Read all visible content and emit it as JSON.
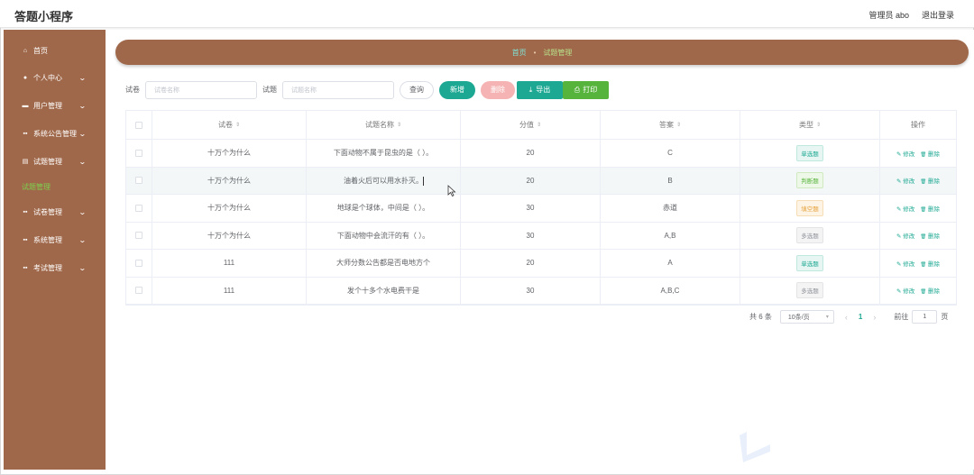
{
  "app": {
    "title": "答题小程序"
  },
  "topbar": {
    "user_label": "管理员 abo",
    "logout_label": "退出登录"
  },
  "sidebar": {
    "items": [
      {
        "label": "首页",
        "icon": "home-icon",
        "glyph": "⌂",
        "has_children": false
      },
      {
        "label": "个人中心",
        "icon": "user-icon",
        "glyph": "●",
        "has_children": true
      },
      {
        "label": "用户管理",
        "icon": "menu-icon",
        "glyph": "▬",
        "has_children": true
      },
      {
        "label": "系统公告管理",
        "icon": "grid-icon",
        "glyph": "▪▪",
        "has_children": true
      },
      {
        "label": "试题管理",
        "icon": "document-icon",
        "glyph": "▤",
        "has_children": true
      },
      {
        "label": "试卷管理",
        "icon": "grid-icon",
        "glyph": "▪▪",
        "has_children": true
      },
      {
        "label": "系统管理",
        "icon": "grid-icon",
        "glyph": "▪▪",
        "has_children": true
      },
      {
        "label": "考试管理",
        "icon": "grid-icon",
        "glyph": "▪▪",
        "has_children": true
      }
    ],
    "active_sub": "试题管理",
    "chevron": "⌄"
  },
  "breadcrumb": {
    "home": "首页",
    "separator": "•",
    "current": "试题管理"
  },
  "search": {
    "paper_label": "试卷",
    "paper_placeholder": "试卷名称",
    "question_label": "试题",
    "question_placeholder": "试题名称",
    "query_button": "查询"
  },
  "toolbar": {
    "add_label": "新增",
    "delete_label": "删除",
    "export_label": "导出",
    "export_icon": "⤓",
    "print_label": "打印",
    "print_icon": "⎙"
  },
  "table": {
    "sort_glyph": "⇕",
    "headers": {
      "paper": "试卷",
      "name": "试题名称",
      "score": "分值",
      "answer": "答案",
      "type": "类型",
      "action": "操作"
    },
    "rows": [
      {
        "paper": "十万个为什么",
        "name": "下面动物不属于昆虫的是（ ）。",
        "score": "20",
        "answer": "C",
        "type": "单选题",
        "type_kind": "single"
      },
      {
        "paper": "十万个为什么",
        "name": "油着火后可以用水扑灭。",
        "score": "20",
        "answer": "B",
        "type": "判断题",
        "type_kind": "judge"
      },
      {
        "paper": "十万个为什么",
        "name": "地球是个球体，中间是（ ）。",
        "score": "30",
        "answer": "赤道",
        "type": "填空题",
        "type_kind": "fill"
      },
      {
        "paper": "十万个为什么",
        "name": "下面动物中会流汗的有（ ）。",
        "score": "30",
        "answer": "A,B",
        "type": "多选题",
        "type_kind": "multi"
      },
      {
        "paper": "111",
        "name": "大师分数公告都是否电地方个",
        "score": "20",
        "answer": "A",
        "type": "单选题",
        "type_kind": "single"
      },
      {
        "paper": "111",
        "name": "发个十多个水电费干是",
        "score": "30",
        "answer": "A,B,C",
        "type": "多选题",
        "type_kind": "multi"
      }
    ],
    "edit_label": "修改",
    "edit_icon": "✎",
    "delete_label": "删除",
    "delete_icon": "🗑"
  },
  "tag_colors": {
    "single": {
      "bg": "#e8f6f3",
      "border": "#bfe8df",
      "text": "#1ca892"
    },
    "judge": {
      "bg": "#eef8e8",
      "border": "#cfeabf",
      "text": "#56b33c"
    },
    "fill": {
      "bg": "#fdf4e6",
      "border": "#f7ddb5",
      "text": "#e6a23c"
    },
    "multi": {
      "bg": "#f4f4f5",
      "border": "#e4e4e6",
      "text": "#909399"
    }
  },
  "pagination": {
    "total": "共 6 条",
    "page_size": "10条/页",
    "prev": "‹",
    "current": "1",
    "next": "›",
    "goto_label": "前往",
    "goto_value": "1",
    "page_unit": "页"
  },
  "colors": {
    "brand": "#a0684a",
    "accent": "#1ca892",
    "print": "#56b33c",
    "delete": "#f5b3b3"
  }
}
